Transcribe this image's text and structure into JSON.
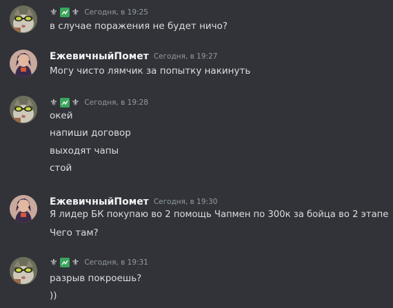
{
  "colors": {
    "background": "#313338",
    "text": "#dbdee1",
    "username": "#f2f3f5",
    "timestamp": "#949ba4",
    "badge_green": "#3ba55c"
  },
  "messages": [
    {
      "author_type": "decorated",
      "author_icons": [
        "fleur-icon",
        "green-check-emoji",
        "fleur-icon"
      ],
      "timestamp": "Сегодня, в 19:25",
      "lines": [
        "в случае поражения не будет ничо?"
      ]
    },
    {
      "author_type": "named",
      "username": "ЕжевичныйПомет",
      "timestamp": "Сегодня, в 19:27",
      "lines": [
        "Могу чисто лямчик за попытку накинуть"
      ]
    },
    {
      "author_type": "decorated",
      "author_icons": [
        "fleur-icon",
        "green-check-emoji",
        "fleur-icon"
      ],
      "timestamp": "Сегодня, в 19:28",
      "lines": [
        "окей",
        "напиши договор",
        "выходят чапы",
        "стой"
      ]
    },
    {
      "author_type": "named",
      "username": "ЕжевичныйПомет",
      "timestamp": "Сегодня, в 19:30",
      "lines": [
        "Я лидер БК покупаю во 2 помощь Чапмен по 300к за бойца во 2 этапе",
        "Чего там?"
      ]
    },
    {
      "author_type": "decorated",
      "author_icons": [
        "fleur-icon",
        "green-check-emoji",
        "fleur-icon"
      ],
      "timestamp": "Сегодня, в 19:31",
      "lines": [
        "разрыв покроешь?",
        "))"
      ]
    }
  ]
}
